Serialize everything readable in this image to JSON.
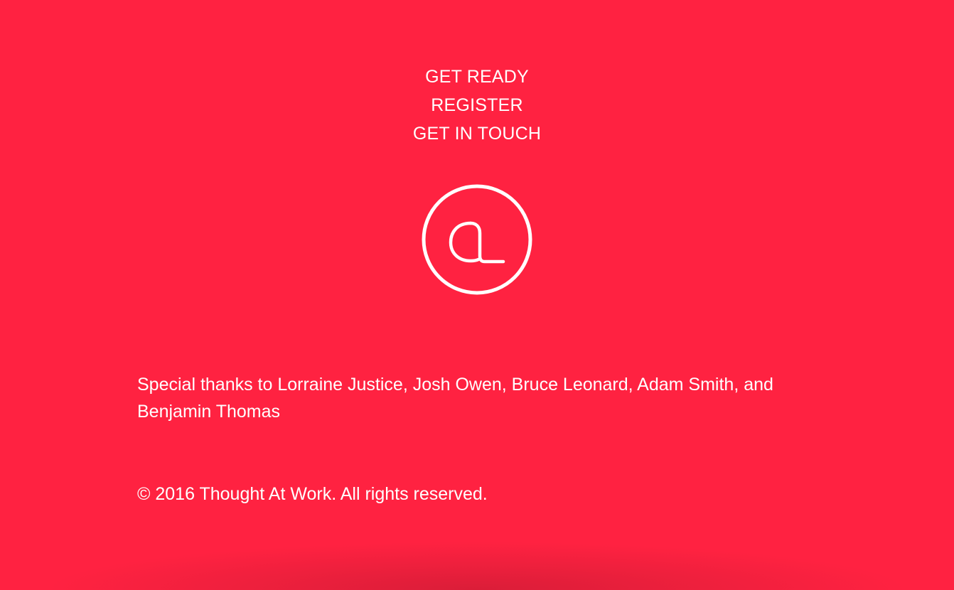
{
  "nav": {
    "items": [
      {
        "label": "GET READY"
      },
      {
        "label": "REGISTER"
      },
      {
        "label": "GET IN TOUCH"
      }
    ]
  },
  "logo": {
    "icon": "at-sign-circle-logo"
  },
  "credits": {
    "thanks": "Special thanks to Lorraine Justice, Josh Owen, Bruce Leonard, Adam Smith, and Benjamin Thomas"
  },
  "copyright": {
    "text": "© 2016 Thought At Work. All rights reserved."
  },
  "colors": {
    "background": "#ff2241",
    "text": "#ffffff"
  }
}
